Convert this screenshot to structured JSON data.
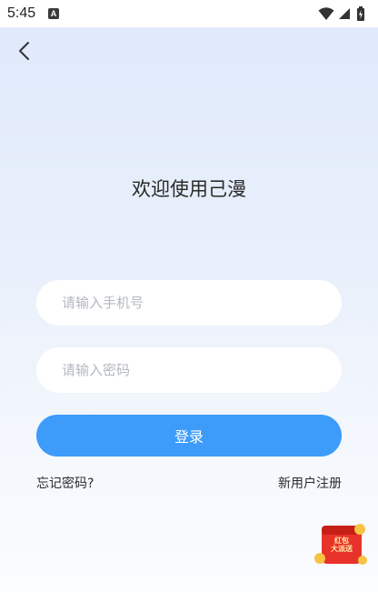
{
  "status_bar": {
    "time": "5:45",
    "a_icon_letter": "A",
    "icons": [
      "notification-a-icon",
      "wifi-icon",
      "signal-icon",
      "battery-icon"
    ]
  },
  "header": {
    "back_icon": "chevron-left-icon"
  },
  "main": {
    "title": "欢迎使用己漫",
    "phone_placeholder": "请输入手机号",
    "password_placeholder": "请输入密码",
    "login_label": "登录",
    "forgot_label": "忘记密码?",
    "register_label": "新用户注册"
  },
  "promo": {
    "red_packet_line1": "红包",
    "red_packet_line2": "大派送",
    "icon": "red-packet-icon"
  },
  "colors": {
    "accent": "#3d9bfa",
    "background_top": "#dfe9fb",
    "background_bottom": "#fbfcfe",
    "text": "#2a2a2a",
    "placeholder": "#b4b8c0"
  }
}
